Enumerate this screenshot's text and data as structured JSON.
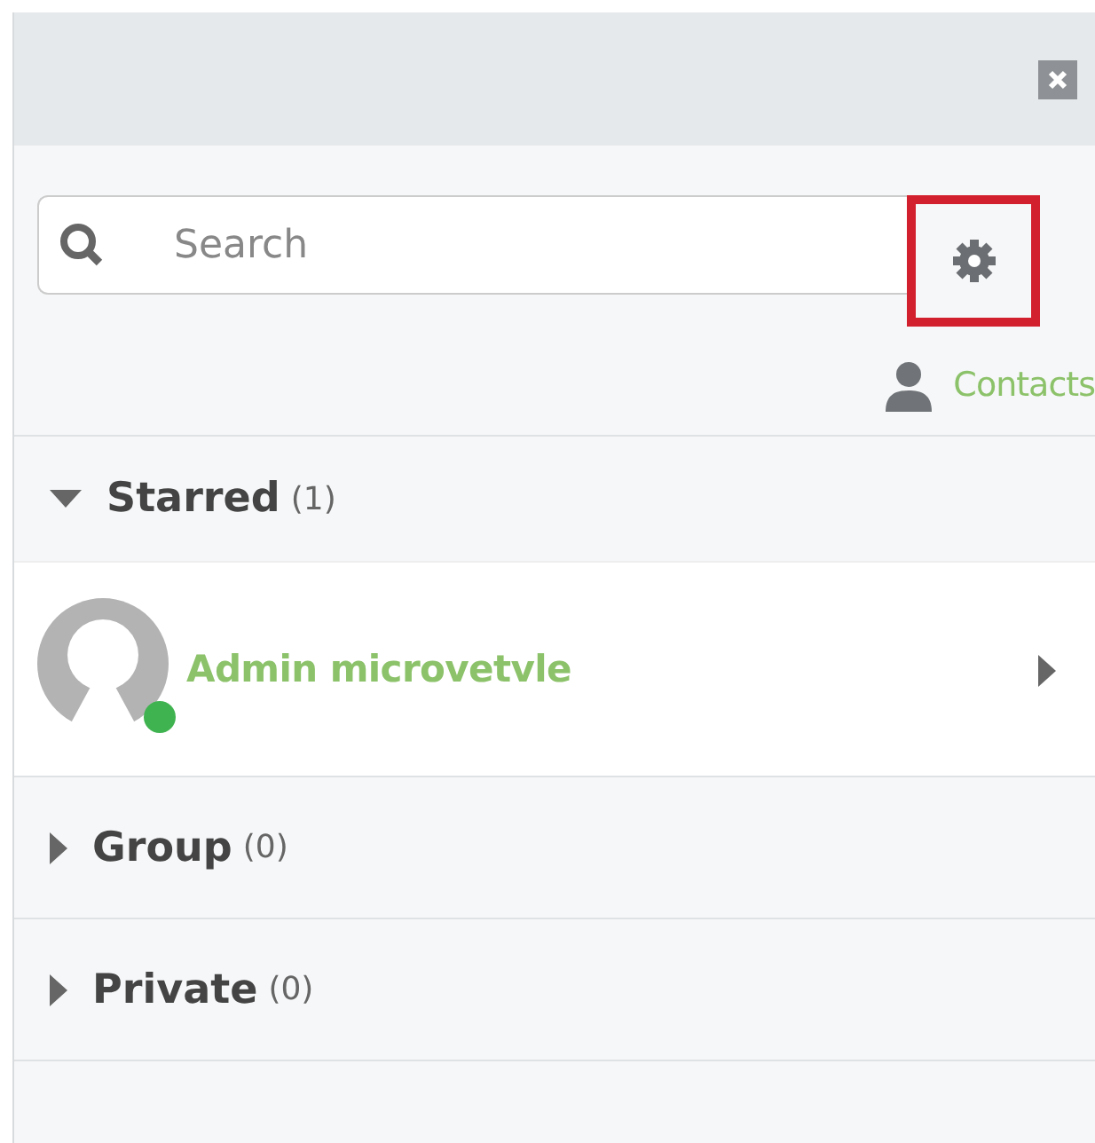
{
  "search": {
    "placeholder": "Search"
  },
  "settings_button": {
    "highlighted": true
  },
  "contacts_link": {
    "label": "Contacts"
  },
  "sections": [
    {
      "label": "Starred",
      "count": "(1)",
      "expanded": true,
      "contacts": [
        {
          "name": "Admin microvetvle",
          "online": true
        }
      ]
    },
    {
      "label": "Group",
      "count": "(0)",
      "expanded": false
    },
    {
      "label": "Private",
      "count": "(0)",
      "expanded": false
    }
  ]
}
